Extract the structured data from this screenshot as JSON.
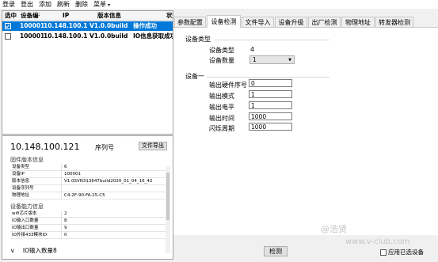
{
  "menubar": {
    "items": [
      {
        "label": "登录"
      },
      {
        "label": "登出"
      },
      {
        "label": "添加"
      },
      {
        "label": "刷新"
      },
      {
        "label": "删除"
      },
      {
        "label": "菜单"
      }
    ]
  },
  "device_list": {
    "columns": [
      "选中",
      "设备编号",
      "IP",
      "版本信息",
      "状态"
    ],
    "rows": [
      {
        "checked": true,
        "selected": true,
        "id": "100001",
        "ip": "10.148.100.121",
        "version": "V1.0.0build 1",
        "status": "操作成功"
      },
      {
        "checked": false,
        "selected": false,
        "id": "100001",
        "ip": "10.148.100.122",
        "version": "V1.0.0build 1",
        "status": "IO信息获取成功"
      }
    ]
  },
  "info": {
    "ip": "10.148.100.121",
    "serial_label": "序列号",
    "export_button": "文件导出",
    "firmware_title": "固件版本信息",
    "firmware": [
      {
        "key": "设备类型",
        "value": "6"
      },
      {
        "key": "设备IP",
        "value": "100001"
      },
      {
        "key": "版本信息",
        "value": "V1.0SVN313647build2020_01_04_16_42"
      },
      {
        "key": "设备序列号",
        "value": ""
      },
      {
        "key": "物理地址",
        "value": "C4-2F-90-FA-25-C5"
      }
    ],
    "capability_title": "设备能力信息",
    "capability": [
      {
        "key": "wifi芯片版本",
        "value": "2"
      },
      {
        "key": "IO输入口数量",
        "value": "8"
      },
      {
        "key": "IO输出口数量",
        "value": "9"
      },
      {
        "key": "IO外接433模块ID",
        "value": "0"
      }
    ],
    "io_count": "IO输入数量8"
  },
  "tabs": [
    {
      "label": "参数配置",
      "active": false
    },
    {
      "label": "设备检测",
      "active": true
    },
    {
      "label": "文件导入",
      "active": false
    },
    {
      "label": "设备升级",
      "active": false
    },
    {
      "label": "出厂检测",
      "active": false
    },
    {
      "label": "物理地址",
      "active": false
    },
    {
      "label": "转发器检测",
      "active": false
    }
  ],
  "device_type_group": {
    "title": "设备类型",
    "type_label": "设备类型",
    "type_value": "4",
    "count_label": "设备数量",
    "count_value": "1"
  },
  "device_one_group": {
    "title": "设备一",
    "fields": [
      {
        "label": "输出硬件序号",
        "value": "0"
      },
      {
        "label": "输出模式",
        "value": "1"
      },
      {
        "label": "输出电平",
        "value": "1"
      },
      {
        "label": "输出时间",
        "value": "1000"
      },
      {
        "label": "闪烁周期",
        "value": "1000"
      }
    ]
  },
  "detect_button": "检测",
  "apply_label": "应用已选设备",
  "watermark": {
    "line1": "@浩贤",
    "line2": "www.v-club.com"
  }
}
